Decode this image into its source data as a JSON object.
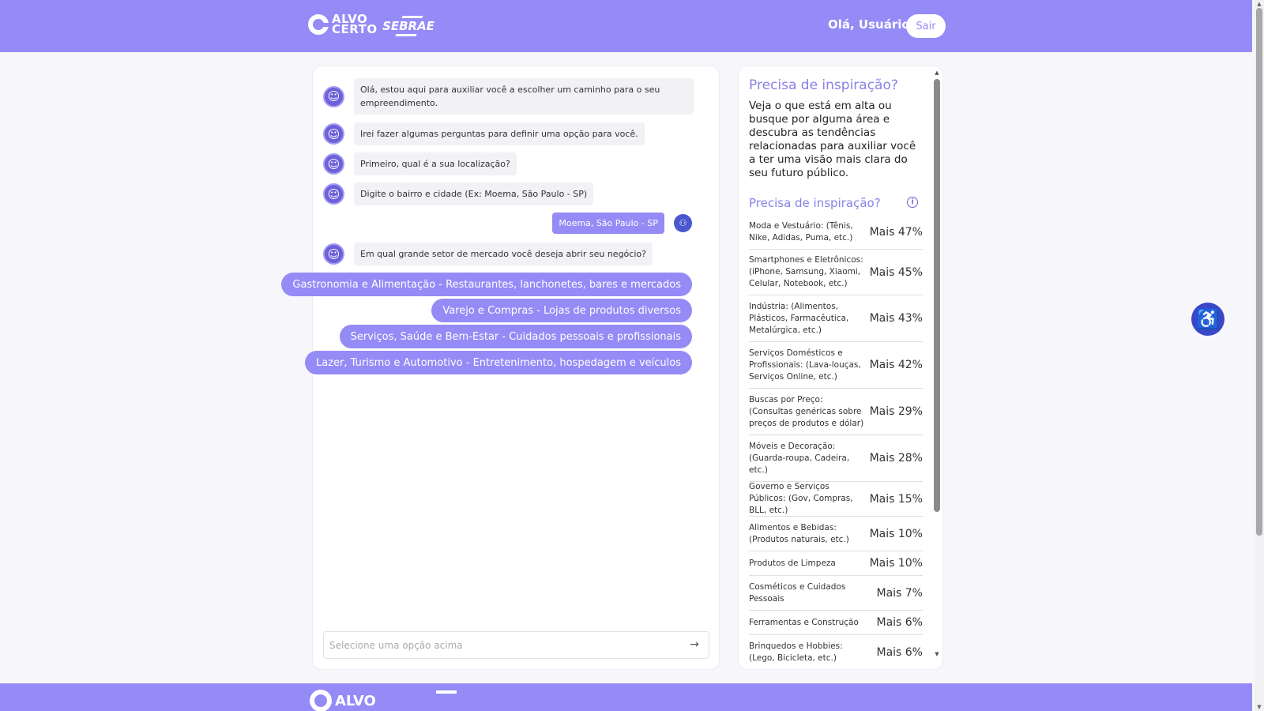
{
  "header": {
    "logo_line1": "ALVO",
    "logo_line2": "CERTO",
    "partner_logo": "SEBRAE",
    "greeting": "Olá, Usuário",
    "logout_label": "Sair"
  },
  "chat": {
    "bot_messages": [
      "Olá, estou aqui para auxiliar você a escolher um caminho para o seu empreendimento.",
      "Irei fazer algumas perguntas para definir uma opção para você.",
      "Primeiro, qual é a sua localização?",
      "Digite o bairro e cidade (Ex: Moema, São Paulo - SP)",
      "Em qual grande setor de mercado você deseja abrir seu negócio?"
    ],
    "user_message": "Moema, São Paulo - SP",
    "options": [
      "Gastronomia e Alimentação - Restaurantes, lanchonetes, bares e mercados",
      "Varejo e Compras - Lojas de produtos diversos",
      "Serviços, Saúde e Bem-Estar - Cuidados pessoais e profissionais",
      "Lazer, Turismo e Automotivo - Entretenimento, hospedagem e veículos"
    ],
    "input_placeholder": "Selecione uma opção acima",
    "bot_icon": "smile-icon",
    "user_icon": "user-icon",
    "send_icon": "arrow-right-icon"
  },
  "inspiration": {
    "title": "Precisa de inspiração?",
    "description": "Veja o que está em alta ou busque por alguma área e descubra as tendências relacionadas para auxiliar você a ter uma visão mais clara do seu futuro público.",
    "subtitle": "Precisa de inspiração?",
    "info_icon": "info-icon",
    "trends": [
      {
        "label": "Moda e Vestuário: (Tênis, Nike, Adidas, Puma, etc.)",
        "value": "Mais 47%"
      },
      {
        "label": "Smartphones e Eletrônicos: (iPhone, Samsung, Xiaomi, Celular, Notebook, etc.)",
        "value": "Mais 45%"
      },
      {
        "label": "Indústria: (Alimentos, Plásticos, Farmacêutica, Metalúrgica, etc.)",
        "value": "Mais 43%"
      },
      {
        "label": "Serviços Domésticos e Profissionais: (Lava-louças, Serviços Online, etc.)",
        "value": "Mais 42%"
      },
      {
        "label": "Buscas por Preço: (Consultas genéricas sobre preços de produtos e dólar)",
        "value": "Mais 29%"
      },
      {
        "label": "Móveis e Decoração: (Guarda-roupa, Cadeira, etc.)",
        "value": "Mais 28%"
      },
      {
        "label": "Governo e Serviços Públicos: (Gov, Compras, BLL, etc.)",
        "value": "Mais 15%"
      },
      {
        "label": "Alimentos e Bebidas: (Produtos naturais, etc.)",
        "value": "Mais 10%"
      },
      {
        "label": "Produtos de Limpeza",
        "value": "Mais 10%"
      },
      {
        "label": "Cosméticos e Cuidados Pessoais",
        "value": "Mais 7%"
      },
      {
        "label": "Ferramentas e Construção",
        "value": "Mais 6%"
      },
      {
        "label": "Brinquedos e Hobbies: (Lego, Bicicleta, etc.)",
        "value": "Mais 6%"
      }
    ]
  },
  "accessibility_icon": "accessibility-icon",
  "footer": {
    "logo_text": "ALVO"
  },
  "colors": {
    "brand": "#958bf6",
    "accent_dark": "#3a47c9",
    "title_purple": "#8a80e8"
  }
}
